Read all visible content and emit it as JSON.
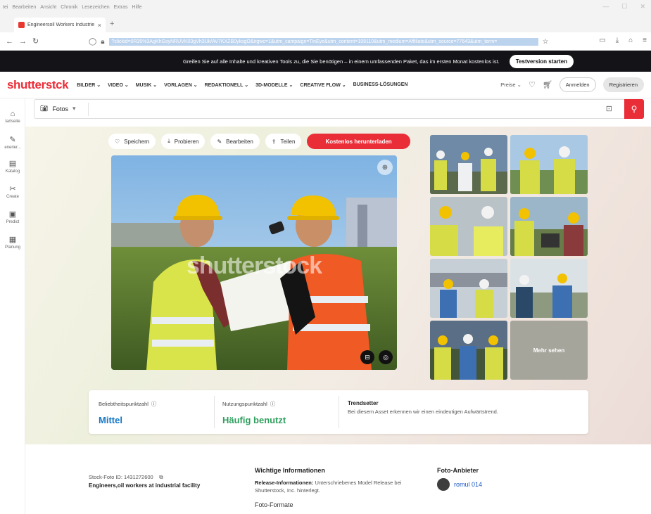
{
  "browser": {
    "menu": [
      "tei",
      "Bearbeiten",
      "Ansicht",
      "Chronik",
      "Lesezeichen",
      "Extras",
      "Hilfe"
    ],
    "tab_title": "Engineersoil Workers Industrie",
    "url": "?clickid=0R35%3AgKhGsyNRUVK03gVh3Uk/AV7KXZB0yksgO&irgwc=1&utm_campaign=TinEye&utm_content=108110&utm_medium=Affiliate&utm_source=77643&utm_term="
  },
  "promo": {
    "text": "Greifen Sie auf alle Inhalte und kreativen Tools zu, die Sie benötigen – in einem umfassenden Paket, das im ersten Monat kostenlos ist.",
    "cta": "Testversion starten"
  },
  "header": {
    "logo": "shutterstck",
    "nav": [
      "BILDER ⌄",
      "VIDEO ⌄",
      "MUSIK ⌄",
      "VORLAGEN ⌄",
      "REDAKTIONELL ⌄",
      "3D-MODELLE ⌄",
      "CREATIVE FLOW ⌄",
      "BUSINESS-LÖSUNGEN"
    ],
    "prices": "Preise ⌄",
    "login": "Anmelden",
    "register": "Registrieren"
  },
  "sidebar": [
    {
      "label": "tartseite",
      "icon": "home-icon"
    },
    {
      "label": "enerier...",
      "icon": "generate-icon"
    },
    {
      "label": "Katalog",
      "icon": "catalog-icon"
    },
    {
      "label": "Create",
      "icon": "create-icon"
    },
    {
      "label": "Predict",
      "icon": "predict-icon"
    },
    {
      "label": "Planung",
      "icon": "planning-icon"
    }
  ],
  "search": {
    "type": "Fotos",
    "placeholder": ""
  },
  "actions": {
    "save": "Speichern",
    "try": "Probieren",
    "edit": "Bearbeiten",
    "share": "Teilen",
    "download": "Kostenlos herunterladen"
  },
  "main_image": {
    "watermark": "shutterstock"
  },
  "thumbs": {
    "more": "Mehr sehen"
  },
  "stats": {
    "popularity": {
      "label": "Beliebtheitspunktzahl",
      "value": "Mittel",
      "color": "#1577c4"
    },
    "usage": {
      "label": "Nutzungspunktzahl",
      "value": "Häufig benutzt",
      "color": "#2f9f5e"
    },
    "trend": {
      "label": "Trendsetter",
      "text": "Bei diesem Asset erkennen wir einen eindeutigen Aufwärtstrend."
    }
  },
  "info": {
    "stock_id": "Stock-Foto ID: 1431272600",
    "photo_title": "Engineers,oil workers at industrial facility",
    "important_heading": "Wichtige Informationen",
    "release_label": "Release-Informationen:",
    "release_text": "Unterschriebenes Model Release bei Shutterstock, Inc. hinterlegt.",
    "formats_heading": "Foto-Formate",
    "provider_heading": "Foto-Anbieter",
    "provider_name": "romul 014"
  },
  "colors": {
    "brand": "#ea2e38",
    "promo_bg": "#131318"
  }
}
